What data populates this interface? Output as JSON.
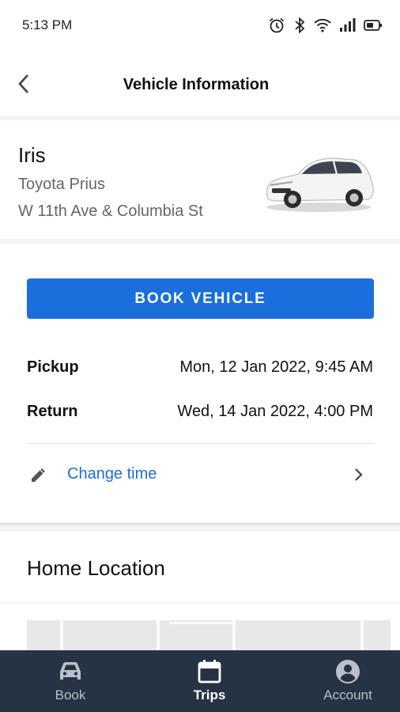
{
  "status_bar": {
    "time": "5:13 PM",
    "icons": [
      "alarm-icon",
      "bluetooth-icon",
      "wifi-icon",
      "signal-icon",
      "battery-icon"
    ]
  },
  "header": {
    "title": "Vehicle Information",
    "back_icon": "chevron-left-icon"
  },
  "vehicle": {
    "name": "Iris",
    "model": "Toyota Prius",
    "address": "W 11th Ave & Columbia St",
    "image": "white hatchback car"
  },
  "booking": {
    "book_label": "BOOK VEHICLE",
    "pickup_label": "Pickup",
    "pickup_value": "Mon, 12 Jan 2022, 9:45 AM",
    "return_label": "Return",
    "return_value": "Wed, 14 Jan 2022, 4:00 PM",
    "change_label": "Change time",
    "change_icon": "pencil-icon"
  },
  "home_location": {
    "title": "Home Location"
  },
  "bottom_nav": {
    "items": [
      {
        "label": "Book",
        "icon": "car-icon",
        "active": false
      },
      {
        "label": "Trips",
        "icon": "calendar-icon",
        "active": true
      },
      {
        "label": "Account",
        "icon": "account-circle-icon",
        "active": false
      }
    ]
  },
  "colors": {
    "accent": "#1a6fdd",
    "nav_background": "#263344",
    "nav_active": "#ffffff",
    "nav_inactive": "#b9c0ca"
  }
}
